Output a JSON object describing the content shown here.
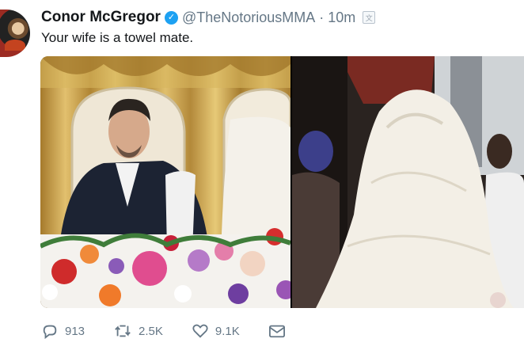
{
  "tweet": {
    "author_name": "Conor McGregor",
    "handle": "@TheNotoriousMMA",
    "separator": "·",
    "time": "10m",
    "text": "Your wife is a towel mate.",
    "actions": {
      "replies": "913",
      "retweets": "2.5K",
      "likes": "9.1K"
    }
  },
  "icons": {
    "verified": "verified-badge-icon",
    "translate": "translate-icon",
    "reply": "reply-icon",
    "retweet": "retweet-icon",
    "like": "heart-icon",
    "message": "envelope-icon"
  },
  "colors": {
    "verified": "#1da1f2",
    "secondary_text": "#657786",
    "primary_text": "#14171a"
  }
}
